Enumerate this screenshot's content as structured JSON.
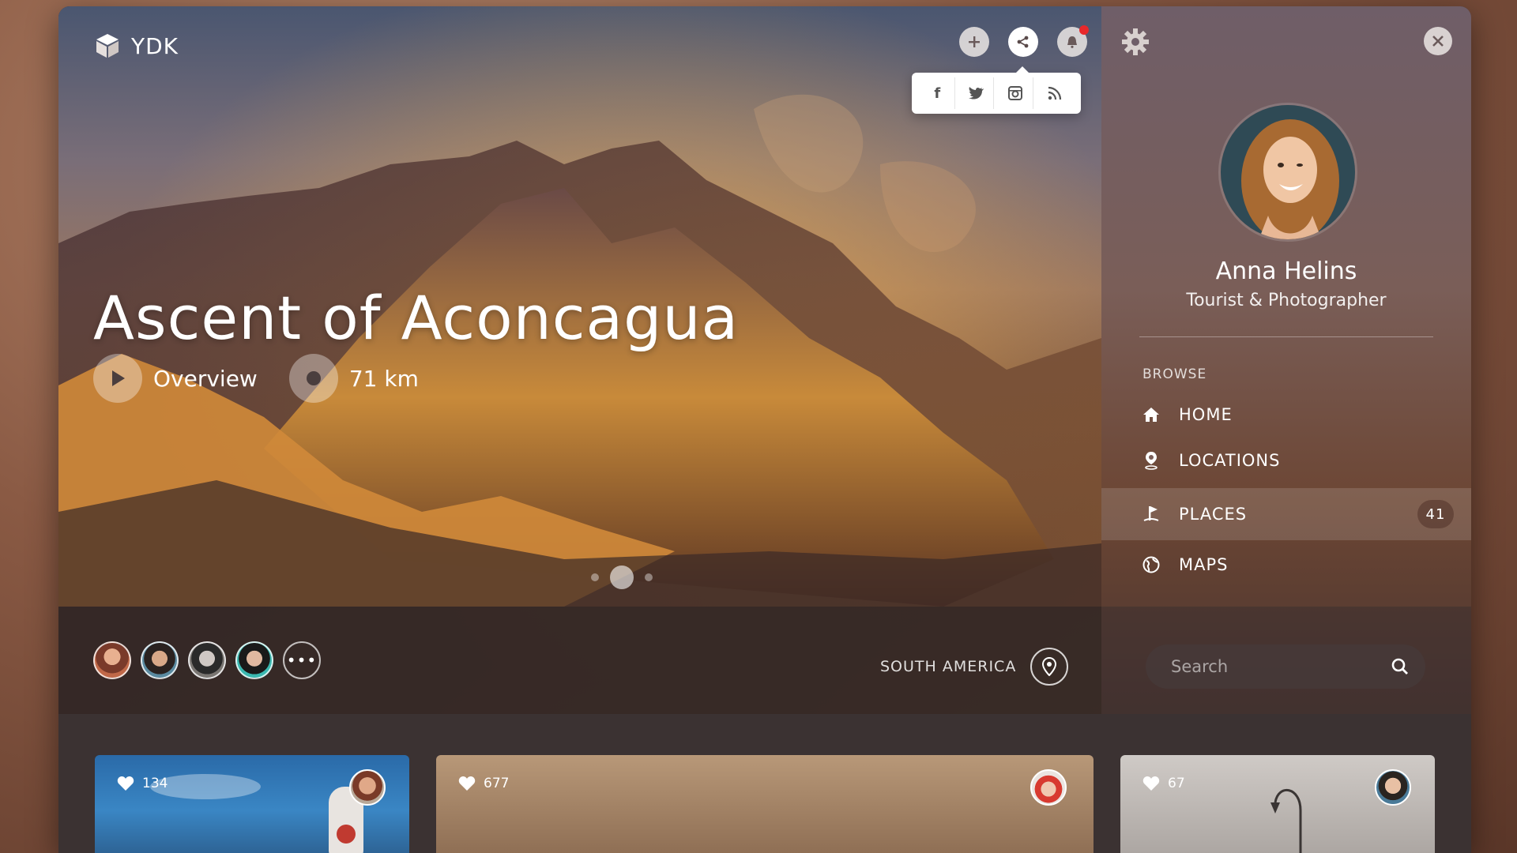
{
  "app": {
    "logo_text": "YDK"
  },
  "header": {
    "icons": [
      "plus-icon",
      "share-icon",
      "bell-icon"
    ],
    "share_menu": [
      "f",
      "twitter",
      "instagram",
      "rss"
    ]
  },
  "hero": {
    "title": "Ascent of Aconcagua",
    "overview_label": "Overview",
    "distance": "71 km",
    "slide_count": 3,
    "active_slide": 1
  },
  "footer_bar": {
    "more_label": "•••",
    "region": "SOUTH AMERICA"
  },
  "profile": {
    "name": "Anna Helins",
    "role": "Tourist & Photographer"
  },
  "sidebar": {
    "section_label": "BROWSE",
    "items": [
      {
        "label": "HOME",
        "icon": "home-icon"
      },
      {
        "label": "LOCATIONS",
        "icon": "pin-icon"
      },
      {
        "label": "PLACES",
        "icon": "flag-icon",
        "badge": "41",
        "active": true
      },
      {
        "label": "MAPS",
        "icon": "globe-icon"
      }
    ]
  },
  "search": {
    "placeholder": "Search"
  },
  "cards": [
    {
      "likes": "134"
    },
    {
      "likes": "677"
    },
    {
      "likes": "67"
    }
  ],
  "colors": {
    "accent": "#e8282b",
    "panel": "#3b3232"
  }
}
